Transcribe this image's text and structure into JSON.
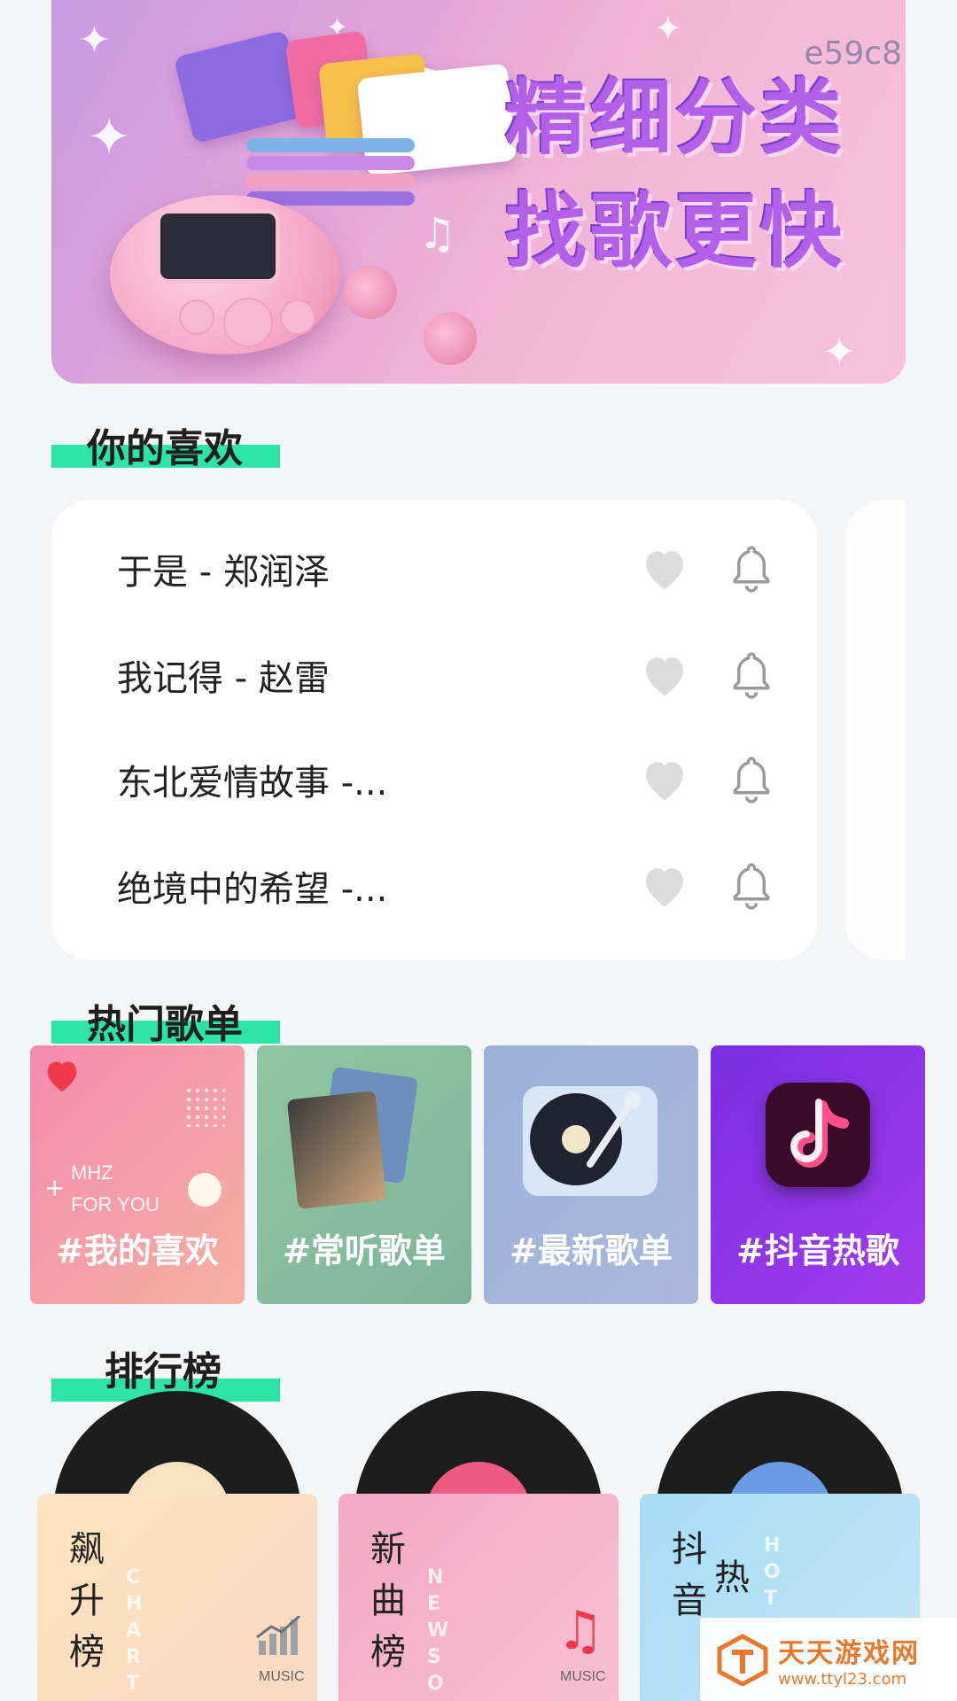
{
  "banner": {
    "code": "e59c8",
    "headline_line1": "精细分类",
    "headline_line2": "找歌更快"
  },
  "favorites": {
    "title": "你的喜欢",
    "songs": [
      {
        "title": "于是 - 郑润泽"
      },
      {
        "title": "我记得 - 赵雷"
      },
      {
        "title": "东北爱情故事 -..."
      },
      {
        "title": "绝境中的希望 -..."
      }
    ]
  },
  "hot_playlists": {
    "title": "热门歌单",
    "items": [
      {
        "label": "#我的喜欢",
        "mhz": "MHZ",
        "for_you": "FOR YOU"
      },
      {
        "label": "#常听歌单"
      },
      {
        "label": "#最新歌单"
      },
      {
        "label": "#抖音热歌"
      }
    ]
  },
  "rankings": {
    "title": "排行榜",
    "items": [
      {
        "vertical": "飙升榜",
        "ghost": "CHARTS",
        "music": "MUSIC"
      },
      {
        "vertical": "新曲榜",
        "ghost": "NEWSON",
        "music": "MUSIC"
      },
      {
        "vertical": "抖音",
        "vertical2": "热",
        "ghost": "HOT"
      }
    ]
  },
  "watermark": {
    "name": "天天游戏网",
    "url": "www.ttyl23.com"
  },
  "colors": {
    "accent_green": "#2ee3a6",
    "heart_gray": "#dcdcdc",
    "heart_red": "#f0384a"
  }
}
